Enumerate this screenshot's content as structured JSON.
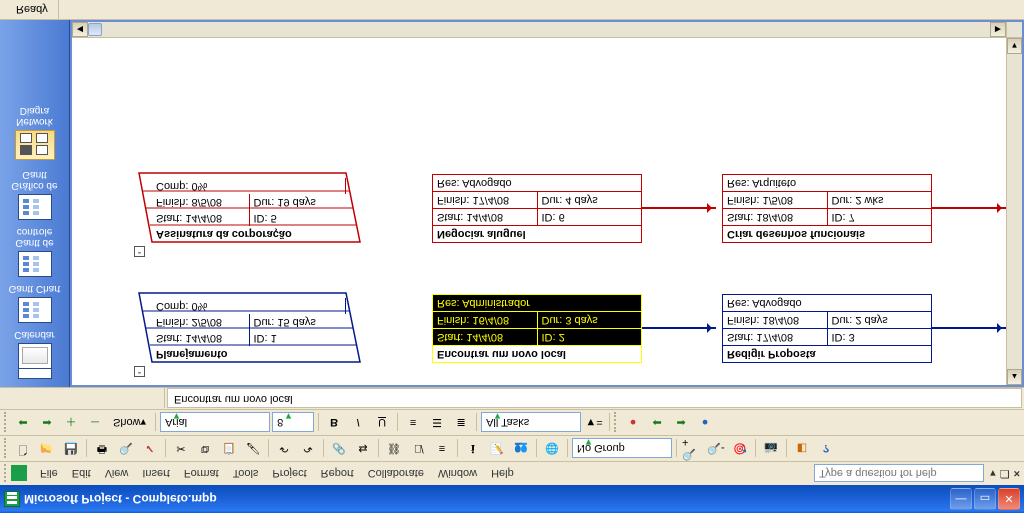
{
  "titlebar": {
    "title": "Microsoft Project - Completo.mpp"
  },
  "menubar": {
    "items": [
      "File",
      "Edit",
      "View",
      "Insert",
      "Format",
      "Tools",
      "Project",
      "Report",
      "Collaborate",
      "Window",
      "Help"
    ],
    "help_placeholder": "Type a question for help"
  },
  "toolbar1": {
    "group_combo": {
      "label": "No Group"
    }
  },
  "toolbar2": {
    "show_label": "Show",
    "font_combo": "Arial",
    "size_combo": "8",
    "filter_combo": "All Tasks"
  },
  "formula": {
    "value": "Encontrar um novo local"
  },
  "viewbar": {
    "items": [
      {
        "label": "Calendar"
      },
      {
        "label": "Gantt Chart"
      },
      {
        "label": "Gantt de controle"
      },
      {
        "label": "Gráfico de Gantt"
      },
      {
        "label": "Network Diagra"
      }
    ]
  },
  "statusbar": {
    "ready": "Ready"
  },
  "nodes": {
    "n1": {
      "title": "Planejamento",
      "start_lbl": "Start:",
      "start": "14/4/08",
      "id_lbl": "ID:",
      "id": "1",
      "finish_lbl": "Finish:",
      "finish": "2/5/08",
      "dur_lbl": "Dur:",
      "dur": "15 days",
      "comp_lbl": "Comp:",
      "comp": "0%"
    },
    "n2": {
      "title": "Encontrar um novo local",
      "start_lbl": "Start:",
      "start": "14/4/08",
      "id_lbl": "ID:",
      "id": "2",
      "finish_lbl": "Finish:",
      "finish": "16/4/08",
      "dur_lbl": "Dur:",
      "dur": "3 days",
      "res_lbl": "Res:",
      "res": "Administrador"
    },
    "n3": {
      "title": "Redigir Proposta",
      "start_lbl": "Start:",
      "start": "17/4/08",
      "id_lbl": "ID:",
      "id": "3",
      "finish_lbl": "Finish:",
      "finish": "18/4/08",
      "dur_lbl": "Dur:",
      "dur": "2 days",
      "res_lbl": "Res:",
      "res": "Advogado"
    },
    "n5": {
      "title": "Assinatura da corporação",
      "start_lbl": "Start:",
      "start": "14/4/08",
      "id_lbl": "ID:",
      "id": "5",
      "finish_lbl": "Finish:",
      "finish": "8/5/08",
      "dur_lbl": "Dur:",
      "dur": "19 days",
      "comp_lbl": "Comp:",
      "comp": "0%"
    },
    "n6": {
      "title": "Negociar aluguel",
      "start_lbl": "Start:",
      "start": "14/4/08",
      "id_lbl": "ID:",
      "id": "6",
      "finish_lbl": "Finish:",
      "finish": "17/4/08",
      "dur_lbl": "Dur:",
      "dur": "4 days",
      "res_lbl": "Res:",
      "res": "Advogado"
    },
    "n7": {
      "title": "Criar desenhos funcionais",
      "start_lbl": "Start:",
      "start": "18/4/08",
      "id_lbl": "ID:",
      "id": "7",
      "finish_lbl": "Finish:",
      "finish": "1/5/08",
      "dur_lbl": "Dur:",
      "dur": "2 wks",
      "res_lbl": "Res:",
      "res": "Arquiteto"
    }
  }
}
